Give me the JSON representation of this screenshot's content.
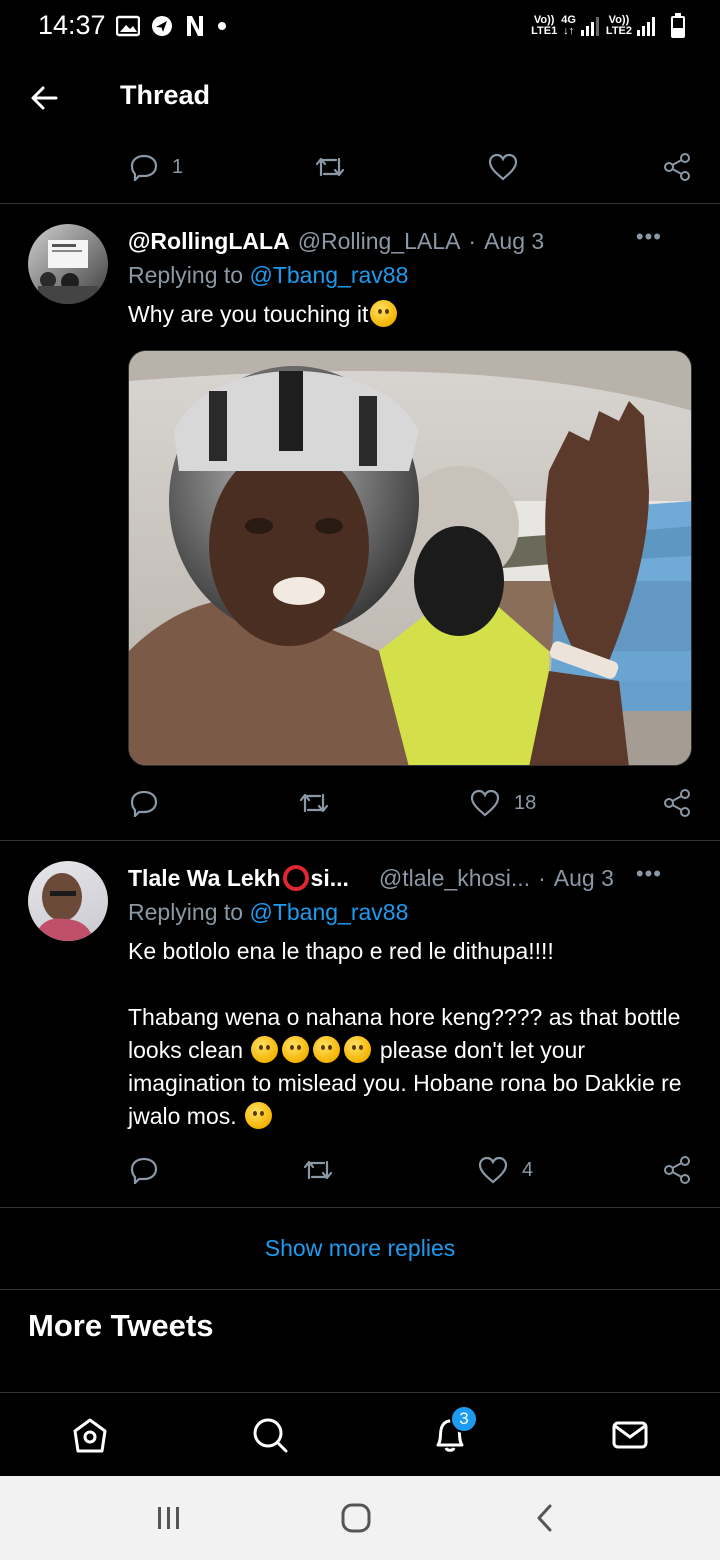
{
  "status_bar": {
    "time": "14:37",
    "left_icons": [
      "image-icon",
      "location-icon",
      "netflix-icon",
      "dot-icon"
    ],
    "sim1_label_top": "Vo))",
    "sim1_label_bottom": "LTE1",
    "net_type": "4G",
    "sim2_label_top": "Vo))",
    "sim2_label_bottom": "LTE2"
  },
  "header": {
    "title": "Thread",
    "back_icon": "arrow-left-icon"
  },
  "top_actions": {
    "reply_count": "1",
    "retweet_count": "",
    "like_count": ""
  },
  "tweets": [
    {
      "display_name": "@RollingLALA",
      "handle": "@Rolling_LALA",
      "dot": "·",
      "date": "Aug 3",
      "replying_prefix": "Replying to",
      "replying_to": "@Tbang_rav88",
      "text": "Why are you touching it",
      "reply_count": "",
      "retweet_count": "",
      "like_count": "18"
    },
    {
      "display_name_a": "Tlale Wa Lekh",
      "display_name_b": "si...",
      "handle": "@tlale_khosi...",
      "dot": "·",
      "date": "Aug 3",
      "replying_prefix": "Replying to",
      "replying_to": "@Tbang_rav88",
      "text_p1": "Ke botlolo ena le thapo e red le dithupa!!!!",
      "text_p2_a": "Thabang wena o nahana hore keng???? as that bottle looks clean",
      "text_p2_b": "please don't let your imagination to mislead you. Hobane rona bo Dakkie re jwalo mos.",
      "reply_count": "",
      "retweet_count": "",
      "like_count": "4"
    }
  ],
  "more_label": "•••",
  "show_more_replies": "Show more replies",
  "more_tweets_heading": "More Tweets",
  "bottom_nav": {
    "items": [
      "home-icon",
      "search-icon",
      "notifications-icon",
      "messages-icon"
    ],
    "notification_badge": "3"
  },
  "system_nav": [
    "recents-icon",
    "home-circle-icon",
    "back-chevron-icon"
  ],
  "colors": {
    "accent": "#1d9bf0",
    "secondary_text": "#8b98a5",
    "background": "#000000",
    "divider": "#2f3336"
  }
}
